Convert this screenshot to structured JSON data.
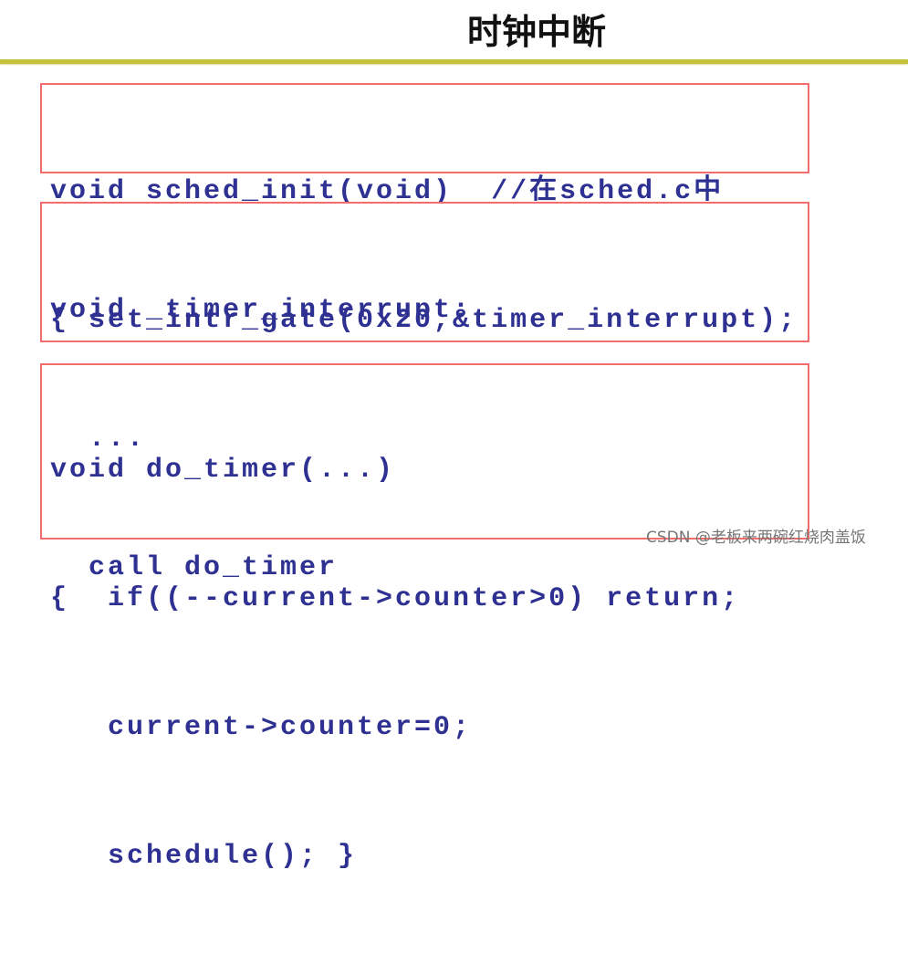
{
  "slide": {
    "title": "时钟中断",
    "colors": {
      "rule": "#c4c23a",
      "box_border": "#f36b6b",
      "code_text": "#2e3192"
    },
    "code_blocks": [
      {
        "lines": [
          "void sched_init(void)  //在sched.c中",
          "{ set_intr_gate(0x20,&timer_interrupt);"
        ]
      },
      {
        "lines": [
          "void _timer_interrupt:",
          "  ...",
          "  call do_timer"
        ]
      },
      {
        "lines": [
          "void do_timer(...)",
          "{  if((--current->counter>0) return;",
          "   current->counter=0;",
          "   schedule(); }"
        ]
      }
    ]
  },
  "watermark": "CSDN @老板来两碗红烧肉盖饭"
}
